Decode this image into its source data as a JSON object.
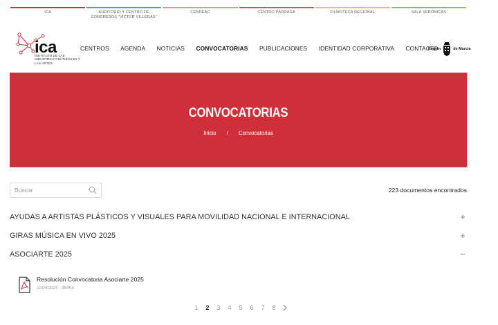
{
  "topbar": {
    "items": [
      {
        "label": "ICA",
        "color": "#c8323a"
      },
      {
        "label": "AUDITORIO Y CENTRO DE CONGRESOS \"VÍCTOR VILLEGAS\"",
        "color": "#5b8fd6"
      },
      {
        "label": "CENDEAC",
        "color": "#e98fa0"
      },
      {
        "label": "CENTRO PÁRRAGA",
        "color": "#e0513b"
      },
      {
        "label": "FILMOTECA REGIONAL",
        "color": "#f2c53d"
      },
      {
        "label": "SALA VERÓNICAS",
        "color": "#8fbf4a"
      }
    ]
  },
  "logo": {
    "name": "ica",
    "subtitle": "INSTITUTO DE LAS INDUSTRIAS CULTURALES Y LAS ARTES",
    "accent": "#c8323a"
  },
  "nav": {
    "items": [
      "CENTROS",
      "AGENDA",
      "NOTICIAS",
      "CONVOCATORIAS",
      "PUBLICACIONES",
      "IDENTIDAD CORPORATIVA",
      "CONTACTO"
    ],
    "active": "CONVOCATORIAS"
  },
  "region": {
    "left": "Región",
    "right": "de Murcia"
  },
  "hero": {
    "title": "CONVOCATORIAS",
    "bg": "#cf2f39",
    "breadcrumb": {
      "home": "Inicio",
      "separator": "/",
      "current": "Convocatorias"
    }
  },
  "search": {
    "placeholder": "Buscar",
    "value": "",
    "icon": "search-icon"
  },
  "results": {
    "count_text": "223 documentos encontrados"
  },
  "accordion": [
    {
      "label": "AYUDAS A ARTISTAS PLÁSTICOS Y VISUALES PARA MOVILIDAD NACIONAL E INTERNACIONAL",
      "toggle": "+",
      "expanded": false
    },
    {
      "label": "GIRAS MÚSICA EN VIVO 2025",
      "toggle": "+",
      "expanded": false
    },
    {
      "label": "ASOCIARTE 2025",
      "toggle": "−",
      "expanded": true
    }
  ],
  "document": {
    "title": "Resolución Convocatoria Asociarte 2025",
    "meta": "11/04/2025 - 364Kb",
    "icon": "pdf-icon"
  },
  "pagination": {
    "pages": [
      "1",
      "2",
      "3",
      "4",
      "5",
      "6",
      "7",
      "8"
    ],
    "current": "2",
    "next_icon": "chevron-right-icon"
  }
}
